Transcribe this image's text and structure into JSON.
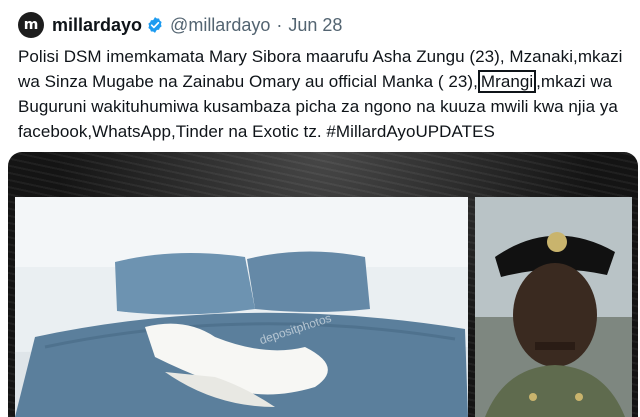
{
  "tweet": {
    "avatar_letter": "m",
    "display_name": "millardayo",
    "handle": "@millardayo",
    "separator": "·",
    "date": "Jun 28",
    "text_before": "Polisi DSM imemkamata Mary Sibora maarufu Asha Zungu (23), Mzanaki,mkazi\nwa Sinza Mugabe na Zainabu Omary au official Manka ( 23),",
    "text_boxed": "Mrangi",
    "text_after": ",mkazi wa\nBuguruni wakituhumiwa kusambaza picha za ngono na kuuza mwili kwa njia ya\nfacebook,WhatsApp,Tinder na Exotic tz. #MillardAyoUPDATES"
  },
  "media": {
    "watermark": "depositphotos"
  },
  "colors": {
    "verified": "#1d9bf0",
    "secondary_text": "#536471",
    "sheet": "#5b7f9c"
  },
  "icons": {
    "verified": "verified-badge-icon"
  }
}
